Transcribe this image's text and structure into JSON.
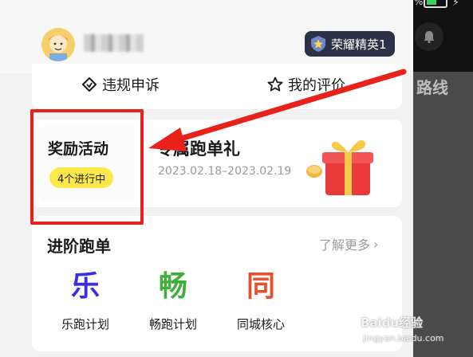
{
  "status": {
    "battery_pct": "%",
    "bolt": "⚡"
  },
  "header": {
    "rank_badge": "荣耀精英1",
    "avatar_icon": "avatar-icon",
    "name_redacted": true
  },
  "links": {
    "appeal": "违规申诉",
    "rating": "我的评价"
  },
  "side": {
    "route": "路线"
  },
  "reward": {
    "title": "奖励活动",
    "badge": "4个进行中",
    "promo_title": "专属跑单礼",
    "promo_date": "2023.02.18–2023.02.19"
  },
  "advanced": {
    "title": "进阶跑单",
    "learn_more": "了解更多",
    "features": [
      {
        "glyph": "乐",
        "label": "乐跑计划"
      },
      {
        "glyph": "畅",
        "label": "畅跑计划"
      },
      {
        "glyph": "同",
        "label": "同城核心"
      }
    ]
  },
  "watermark": {
    "brand": "Baidu经验",
    "url": "jingyan.baidu.com"
  },
  "colors": {
    "highlight": "#e8221b",
    "badge_yellow": "#ffe94a",
    "rank_bg": "#2b3245"
  }
}
